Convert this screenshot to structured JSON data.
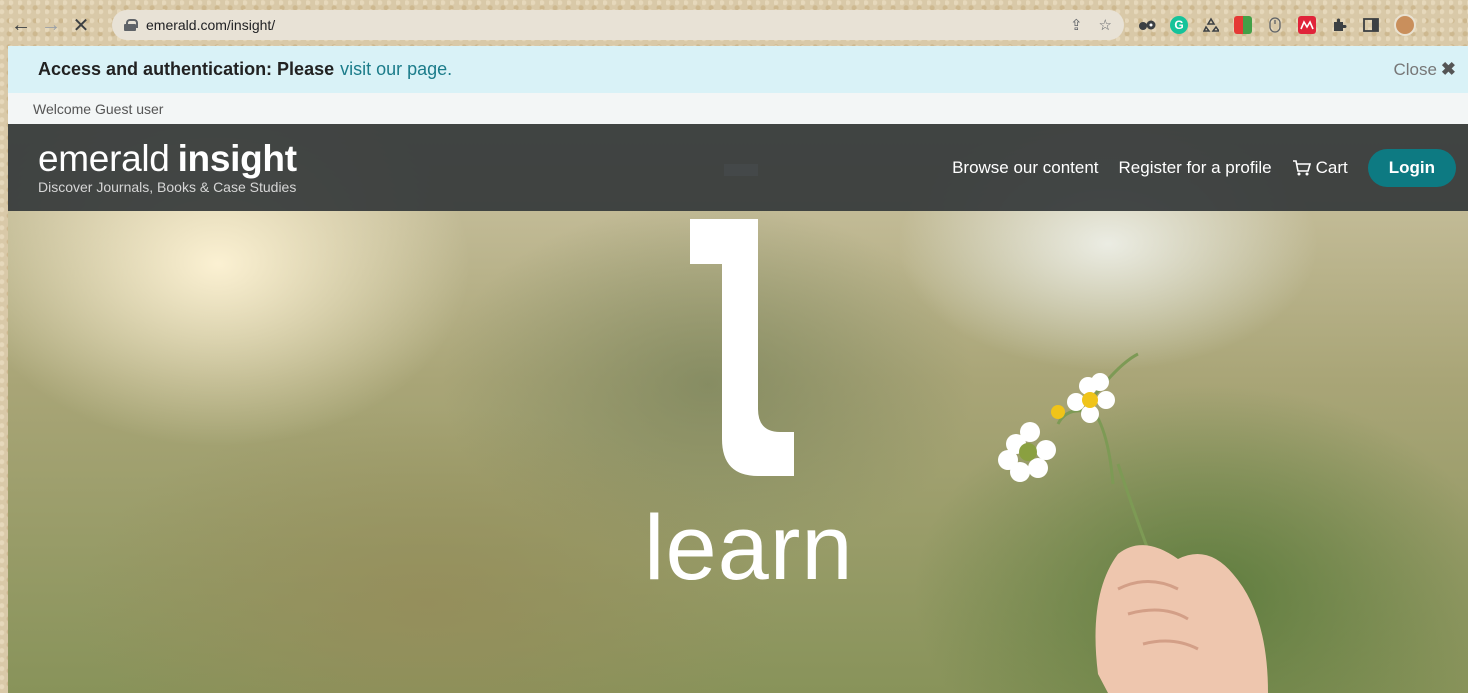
{
  "browser": {
    "url": "emerald.com/insight/",
    "back_icon": "←",
    "forward_icon": "→",
    "stop_icon": "✕",
    "share_icon": "⇪",
    "star_icon": "☆",
    "grammarly_label": "G"
  },
  "notice": {
    "strong_text": "Access and authentication: Please",
    "link_text": "visit our page.",
    "close_label": "Close",
    "close_icon": "✖"
  },
  "welcome": {
    "text": "Welcome Guest user"
  },
  "header": {
    "brand_light": "emerald",
    "brand_bold": "insight",
    "tagline": "Discover Journals, Books & Case Studies",
    "nav": {
      "browse": "Browse our content",
      "register": "Register for a profile",
      "cart": "Cart",
      "login": "Login"
    }
  },
  "hero": {
    "word": "learn"
  },
  "colors": {
    "notice_bg": "#d9f2f7",
    "link": "#1b7c8a",
    "header_bg": "#34383a",
    "login_bg": "#0d7a82"
  }
}
